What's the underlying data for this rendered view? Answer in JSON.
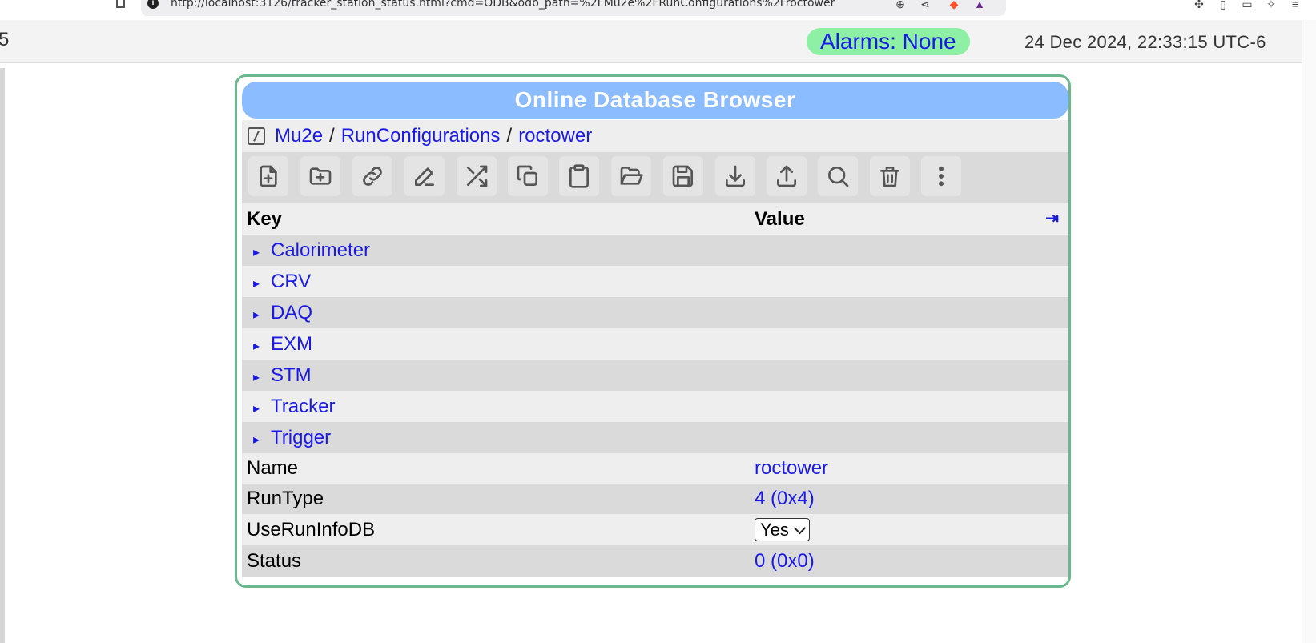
{
  "browser": {
    "url": "http://localhost:3126/tracker_station_status.html?cmd=ODB&odb_path=%2FMu2e%2FRunConfigurations%2Froctower"
  },
  "header": {
    "left_cut_text": "5",
    "alarms": "Alarms: None",
    "datetime": "24 Dec 2024, 22:33:15 UTC-6"
  },
  "odb": {
    "title": "Online Database Browser",
    "breadcrumb": [
      {
        "label": "Mu2e"
      },
      {
        "label": "RunConfigurations"
      },
      {
        "label": "roctower"
      }
    ],
    "separator": "/",
    "toolbar": [
      {
        "icon": "file-plus-icon"
      },
      {
        "icon": "folder-plus-icon"
      },
      {
        "icon": "link-icon"
      },
      {
        "icon": "edit-icon"
      },
      {
        "icon": "shuffle-icon"
      },
      {
        "icon": "copy-icon"
      },
      {
        "icon": "clipboard-icon"
      },
      {
        "icon": "folder-open-icon"
      },
      {
        "icon": "save-icon"
      },
      {
        "icon": "download-icon"
      },
      {
        "icon": "upload-icon"
      },
      {
        "icon": "search-icon"
      },
      {
        "icon": "trash-icon"
      },
      {
        "icon": "more-icon"
      }
    ],
    "columns": {
      "key": "Key",
      "value": "Value",
      "expand_glyph": "⇥"
    },
    "folders": [
      "Calorimeter",
      "CRV",
      "DAQ",
      "EXM",
      "STM",
      "Tracker",
      "Trigger"
    ],
    "folder_glyph": "▸",
    "entries": [
      {
        "key": "Name",
        "value": "roctower"
      },
      {
        "key": "RunType",
        "value": "4 (0x4)"
      },
      {
        "key": "UseRunInfoDB",
        "select": "Yes"
      },
      {
        "key": "Status",
        "value": "0 (0x0)"
      }
    ]
  }
}
